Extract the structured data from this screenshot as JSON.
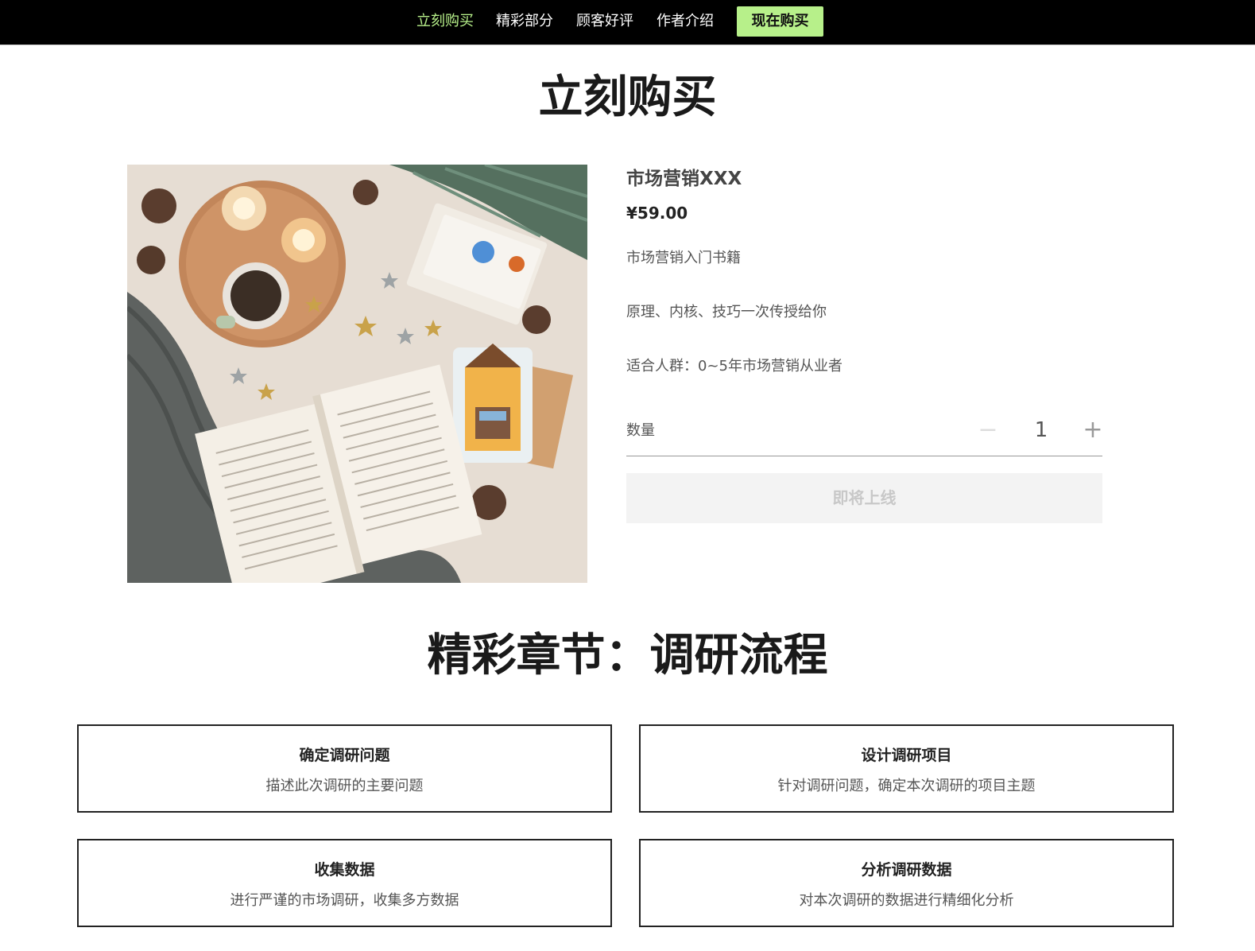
{
  "nav": {
    "links": [
      "立刻购买",
      "精彩部分",
      "顾客好评",
      "作者介绍"
    ],
    "cta": "现在购买"
  },
  "buy_section": {
    "title": "立刻购买",
    "product": {
      "name": "市场营销XXX",
      "price": "¥59.00",
      "desc_1": "市场营销入门书籍",
      "desc_2": "原理、内核、技巧一次传授给你",
      "desc_3": "适合人群：0~5年市场营销从业者",
      "qty_label": "数量",
      "qty_minus": "−",
      "qty_value": "1",
      "qty_plus": "+",
      "button": "即将上线"
    }
  },
  "chapter_section": {
    "title": "精彩章节：调研流程",
    "cards": [
      {
        "title": "确定调研问题",
        "desc": "描述此次调研的主要问题"
      },
      {
        "title": "设计调研项目",
        "desc": "针对调研问题，确定本次调研的项目主题"
      },
      {
        "title": "收集数据",
        "desc": "进行严谨的市场调研，收集多方数据"
      },
      {
        "title": "分析调研数据",
        "desc": "对本次调研的数据进行精细化分析"
      }
    ]
  },
  "colors": {
    "nav_bg": "#000000",
    "accent": "#b7f08a"
  }
}
